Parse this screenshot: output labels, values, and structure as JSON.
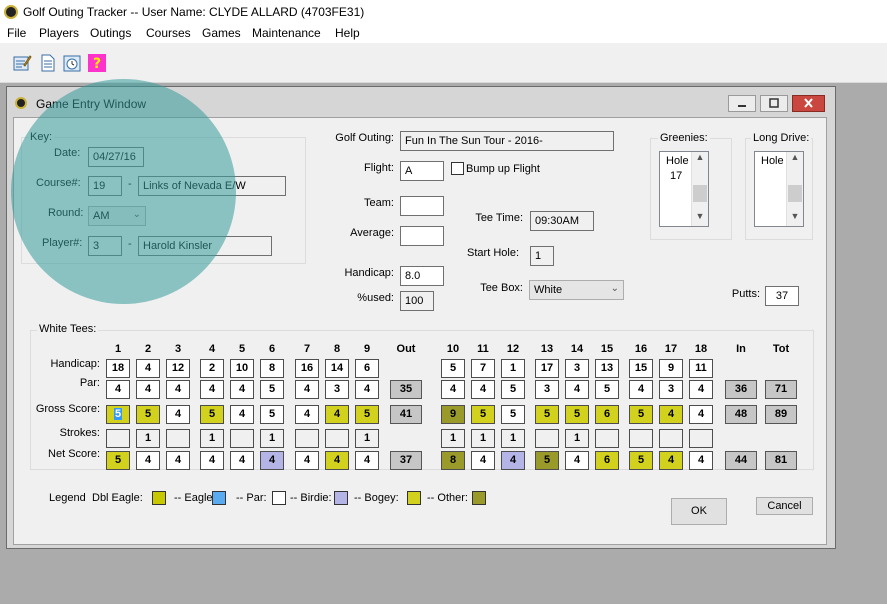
{
  "app": {
    "title": "Golf Outing Tracker -- User Name: CLYDE ALLARD (4703FE31)"
  },
  "menu": [
    "File",
    "Players",
    "Outings",
    "Courses",
    "Games",
    "Maintenance",
    "Help"
  ],
  "toolbar": {
    "icons": [
      "list-edit-icon",
      "document-icon",
      "clock-icon",
      "help-icon"
    ]
  },
  "window": {
    "title": "Game Entry Window"
  },
  "key": {
    "caption": "Key:",
    "date_label": "Date:",
    "date": "04/27/16",
    "course_label": "Course#:",
    "course_num": "19",
    "course_name": "Links of Nevada E/W",
    "round_label": "Round:",
    "round": "AM",
    "player_label": "Player#:",
    "player_num": "3",
    "player_name": "Harold Kinsler",
    "dash": "-"
  },
  "form": {
    "outing_label": "Golf Outing:",
    "outing": "Fun In The Sun Tour - 2016-",
    "flight_label": "Flight:",
    "flight": "A",
    "bump_label": "Bump up Flight",
    "team_label": "Team:",
    "team": "",
    "average_label": "Average:",
    "average": "",
    "handicap_label": "Handicap:",
    "handicap": "8.0",
    "used_label": "%used:",
    "used": "100",
    "tee_time_label": "Tee Time:",
    "tee_time": "09:30AM",
    "start_hole_label": "Start Hole:",
    "start_hole": "1",
    "tee_box_label": "Tee Box:",
    "tee_box": "White",
    "putts_label": "Putts:",
    "putts": "37"
  },
  "greenies": {
    "caption": "Greenies:",
    "header": "Hole",
    "items": [
      "17"
    ]
  },
  "long_drive": {
    "caption": "Long Drive:",
    "header": "Hole",
    "items": []
  },
  "scorecard": {
    "caption": "White Tees:",
    "row_labels": {
      "handicap": "Handicap:",
      "par": "Par:",
      "gross": "Gross Score:",
      "strokes": "Strokes:",
      "net": "Net Score:"
    },
    "front_holes": [
      "1",
      "2",
      "3",
      "4",
      "5",
      "6",
      "7",
      "8",
      "9"
    ],
    "back_holes": [
      "10",
      "11",
      "12",
      "13",
      "14",
      "15",
      "16",
      "17",
      "18"
    ],
    "out_label": "Out",
    "in_label": "In",
    "tot_label": "Tot",
    "handicap": [
      "18",
      "4",
      "12",
      "2",
      "10",
      "8",
      "16",
      "14",
      "6",
      "5",
      "7",
      "1",
      "17",
      "3",
      "13",
      "15",
      "9",
      "11"
    ],
    "par": [
      "4",
      "4",
      "4",
      "4",
      "4",
      "5",
      "4",
      "3",
      "4",
      "4",
      "4",
      "5",
      "3",
      "4",
      "5",
      "4",
      "3",
      "4"
    ],
    "gross": [
      "5",
      "5",
      "4",
      "5",
      "4",
      "5",
      "4",
      "4",
      "5",
      "9",
      "5",
      "5",
      "5",
      "5",
      "6",
      "5",
      "4",
      "4"
    ],
    "strokes": [
      "",
      "1",
      "",
      "1",
      "",
      "1",
      "",
      "",
      "1",
      "1",
      "1",
      "1",
      "",
      "1",
      "",
      "",
      "",
      ""
    ],
    "net": [
      "5",
      "4",
      "4",
      "4",
      "4",
      "4",
      "4",
      "4",
      "4",
      "8",
      "4",
      "4",
      "5",
      "4",
      "6",
      "5",
      "4",
      "4"
    ],
    "gross_class": [
      "bogey",
      "bogey",
      "par",
      "bogey",
      "par",
      "par",
      "par",
      "birdie-bogey-ish",
      "bogey",
      "other",
      "bogey",
      "par",
      "bogey",
      "bogey",
      "bogey",
      "bogey",
      "bogey",
      "par"
    ],
    "par_totals": {
      "out": "35",
      "in": "36",
      "tot": "71"
    },
    "gross_totals": {
      "out": "41",
      "in": "48",
      "tot": "89"
    },
    "net_totals": {
      "out": "37",
      "in": "44",
      "tot": "81"
    }
  },
  "legend": {
    "title": "Legend",
    "items": [
      {
        "label": "Dbl Eagle:",
        "color": "#c8c800"
      },
      {
        "label": "-- Eagle:",
        "color": "#5aaaf0"
      },
      {
        "label": "-- Par:",
        "color": "#ffffff"
      },
      {
        "label": "-- Birdie:",
        "color": "#b4b4e6"
      },
      {
        "label": "-- Bogey:",
        "color": "#d2d21e"
      },
      {
        "label": "-- Other:",
        "color": "#999a2a"
      }
    ]
  },
  "buttons": {
    "ok": "OK",
    "cancel": "Cancel"
  },
  "colors": {
    "bogey": "#d2d21e",
    "other": "#999a2a",
    "birdie": "#b4b4e6",
    "par": "#ffffff",
    "highlight": "#379b9b"
  }
}
